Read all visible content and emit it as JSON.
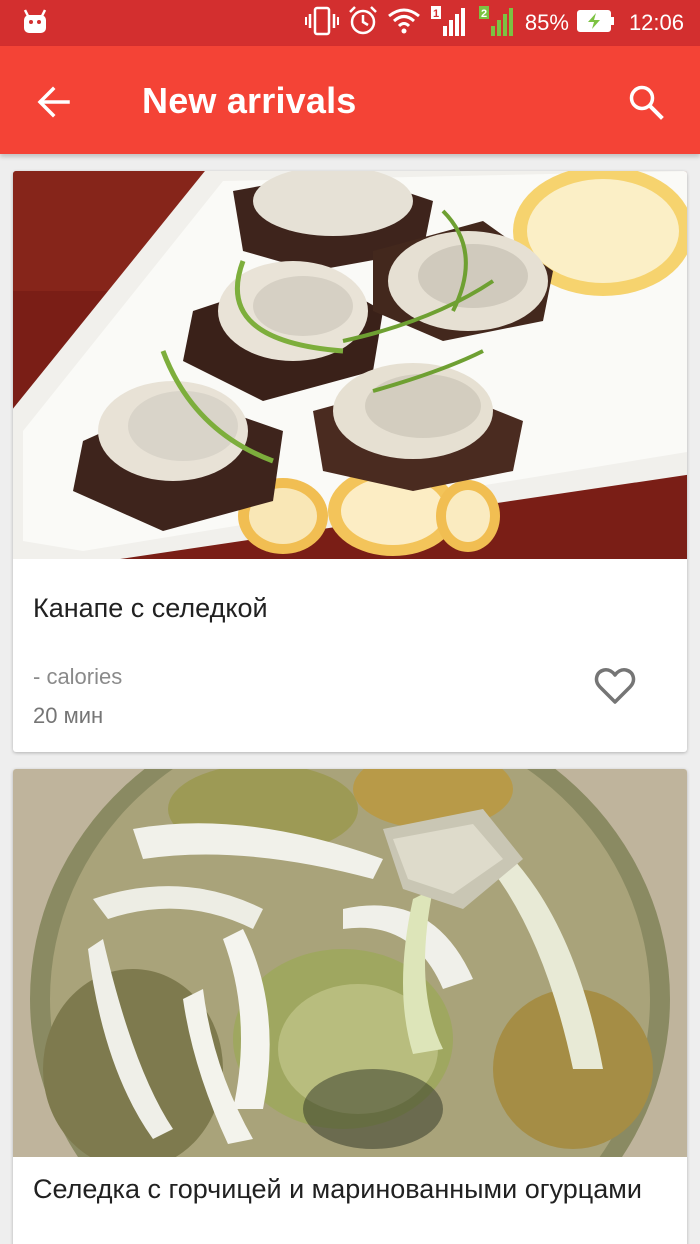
{
  "status_bar": {
    "battery_percent": "85%",
    "time": "12:06",
    "sim1_label": "1",
    "sim2_label": "2",
    "icons": [
      "android-icon",
      "vibrate-icon",
      "alarm-icon",
      "wifi-icon",
      "signal-icon",
      "battery-charging-icon"
    ]
  },
  "app_bar": {
    "title": "New arrivals",
    "back_icon": "arrow-back-icon",
    "search_icon": "search-icon",
    "color": "#F44336",
    "status_color": "#D32F2F"
  },
  "recipes": [
    {
      "title": "Канапе с селедкой",
      "calories": "- calories",
      "time": "20 мин",
      "favorite_icon": "heart-outline-icon"
    },
    {
      "title": "Селедка с горчицей и маринованными огурцами"
    }
  ]
}
